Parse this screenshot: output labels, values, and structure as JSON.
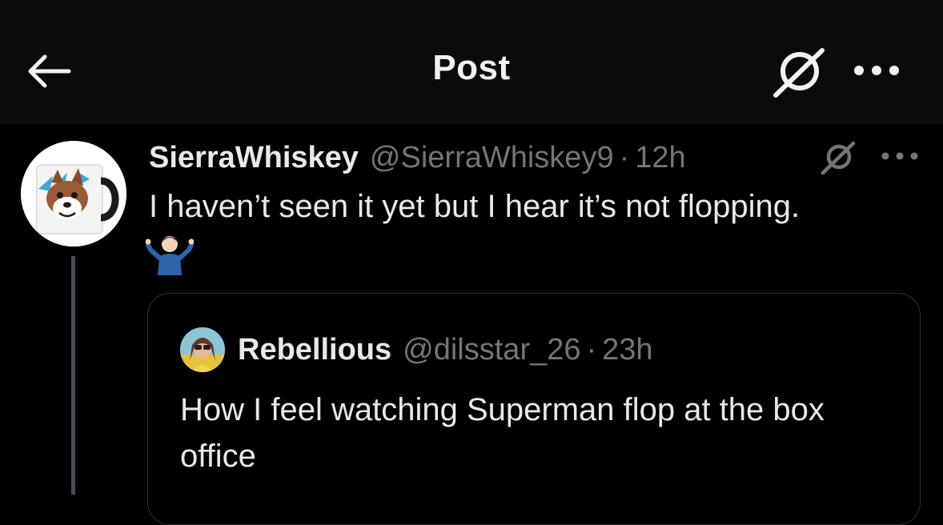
{
  "header": {
    "title": "Post",
    "back_icon": "arrow-left-icon",
    "grok_icon": "grok-icon",
    "more_icon": "more-horizontal-icon"
  },
  "tweet": {
    "display_name": "SierraWhiskey",
    "handle": "@SierraWhiskey9",
    "separator": "·",
    "time": "12h",
    "text": "I haven’t seen it yet but I hear it’s not flopping.",
    "emoji": "man-shrugging-emoji",
    "avatar": "wolf-mug-avatar"
  },
  "quote": {
    "display_name": "Rebellious",
    "handle": "@dilsstar_26",
    "separator": "·",
    "time": "23h",
    "text": "How I feel watching Superman flop at the box office",
    "avatar": "user-photo-avatar"
  },
  "colors": {
    "background": "#000000",
    "topbar": "#0b0b0b",
    "text_primary": "#e7e9ea",
    "text_secondary": "#71767b",
    "border": "#2f3336",
    "thread_line": "#4a4d52"
  }
}
